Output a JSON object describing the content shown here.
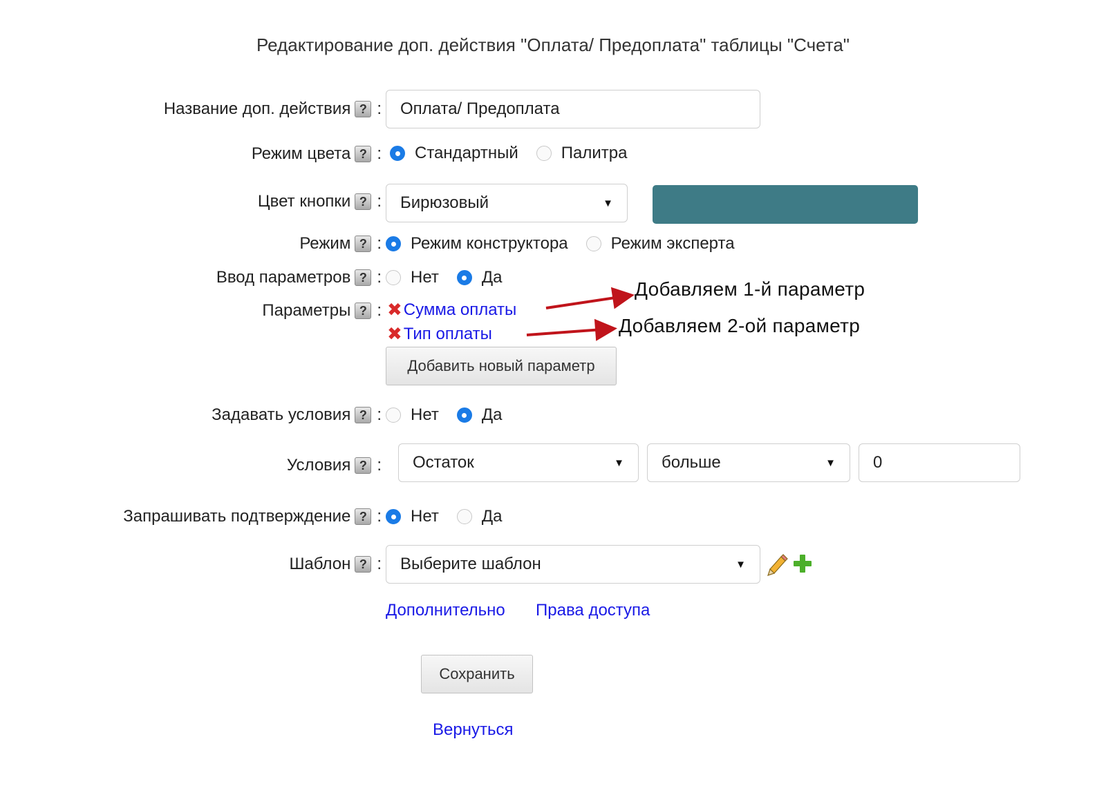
{
  "title": "Редактирование доп. действия \"Оплата/ Предоплата\" таблицы \"Счета\"",
  "help_glyph": "?",
  "colon": ":",
  "name_field": {
    "label": "Название доп. действия",
    "value": "Оплата/ Предоплата"
  },
  "color_mode": {
    "label": "Режим цвета",
    "options": [
      "Стандартный",
      "Палитра"
    ],
    "selected": "Стандартный"
  },
  "button_color": {
    "label": "Цвет кнопки",
    "value": "Бирюзовый",
    "swatch_color": "#3e7b86"
  },
  "mode": {
    "label": "Режим",
    "options": [
      "Режим конструктора",
      "Режим эксперта"
    ],
    "selected": "Режим конструктора"
  },
  "param_input": {
    "label": "Ввод параметров",
    "options": [
      "Нет",
      "Да"
    ],
    "selected": "Да"
  },
  "parameters": {
    "label": "Параметры",
    "items": [
      "Сумма оплаты",
      "Тип оплаты"
    ],
    "add_button": "Добавить новый параметр"
  },
  "set_conditions": {
    "label": "Задавать условия",
    "options": [
      "Нет",
      "Да"
    ],
    "selected": "Да"
  },
  "conditions": {
    "label": "Условия",
    "field": "Остаток",
    "operator": "больше",
    "value": "0"
  },
  "ask_confirmation": {
    "label": "Запрашивать подтверждение",
    "options": [
      "Нет",
      "Да"
    ],
    "selected": "Нет"
  },
  "template": {
    "label": "Шаблон",
    "value": "Выберите шаблон"
  },
  "links": {
    "extra": "Дополнительно",
    "access": "Права доступа"
  },
  "save_button": "Сохранить",
  "back_link": "Вернуться",
  "annotations": {
    "first": "Добавляем 1-й параметр",
    "second": "Добавляем 2-ой параметр",
    "arrow_color": "#c0141b"
  }
}
